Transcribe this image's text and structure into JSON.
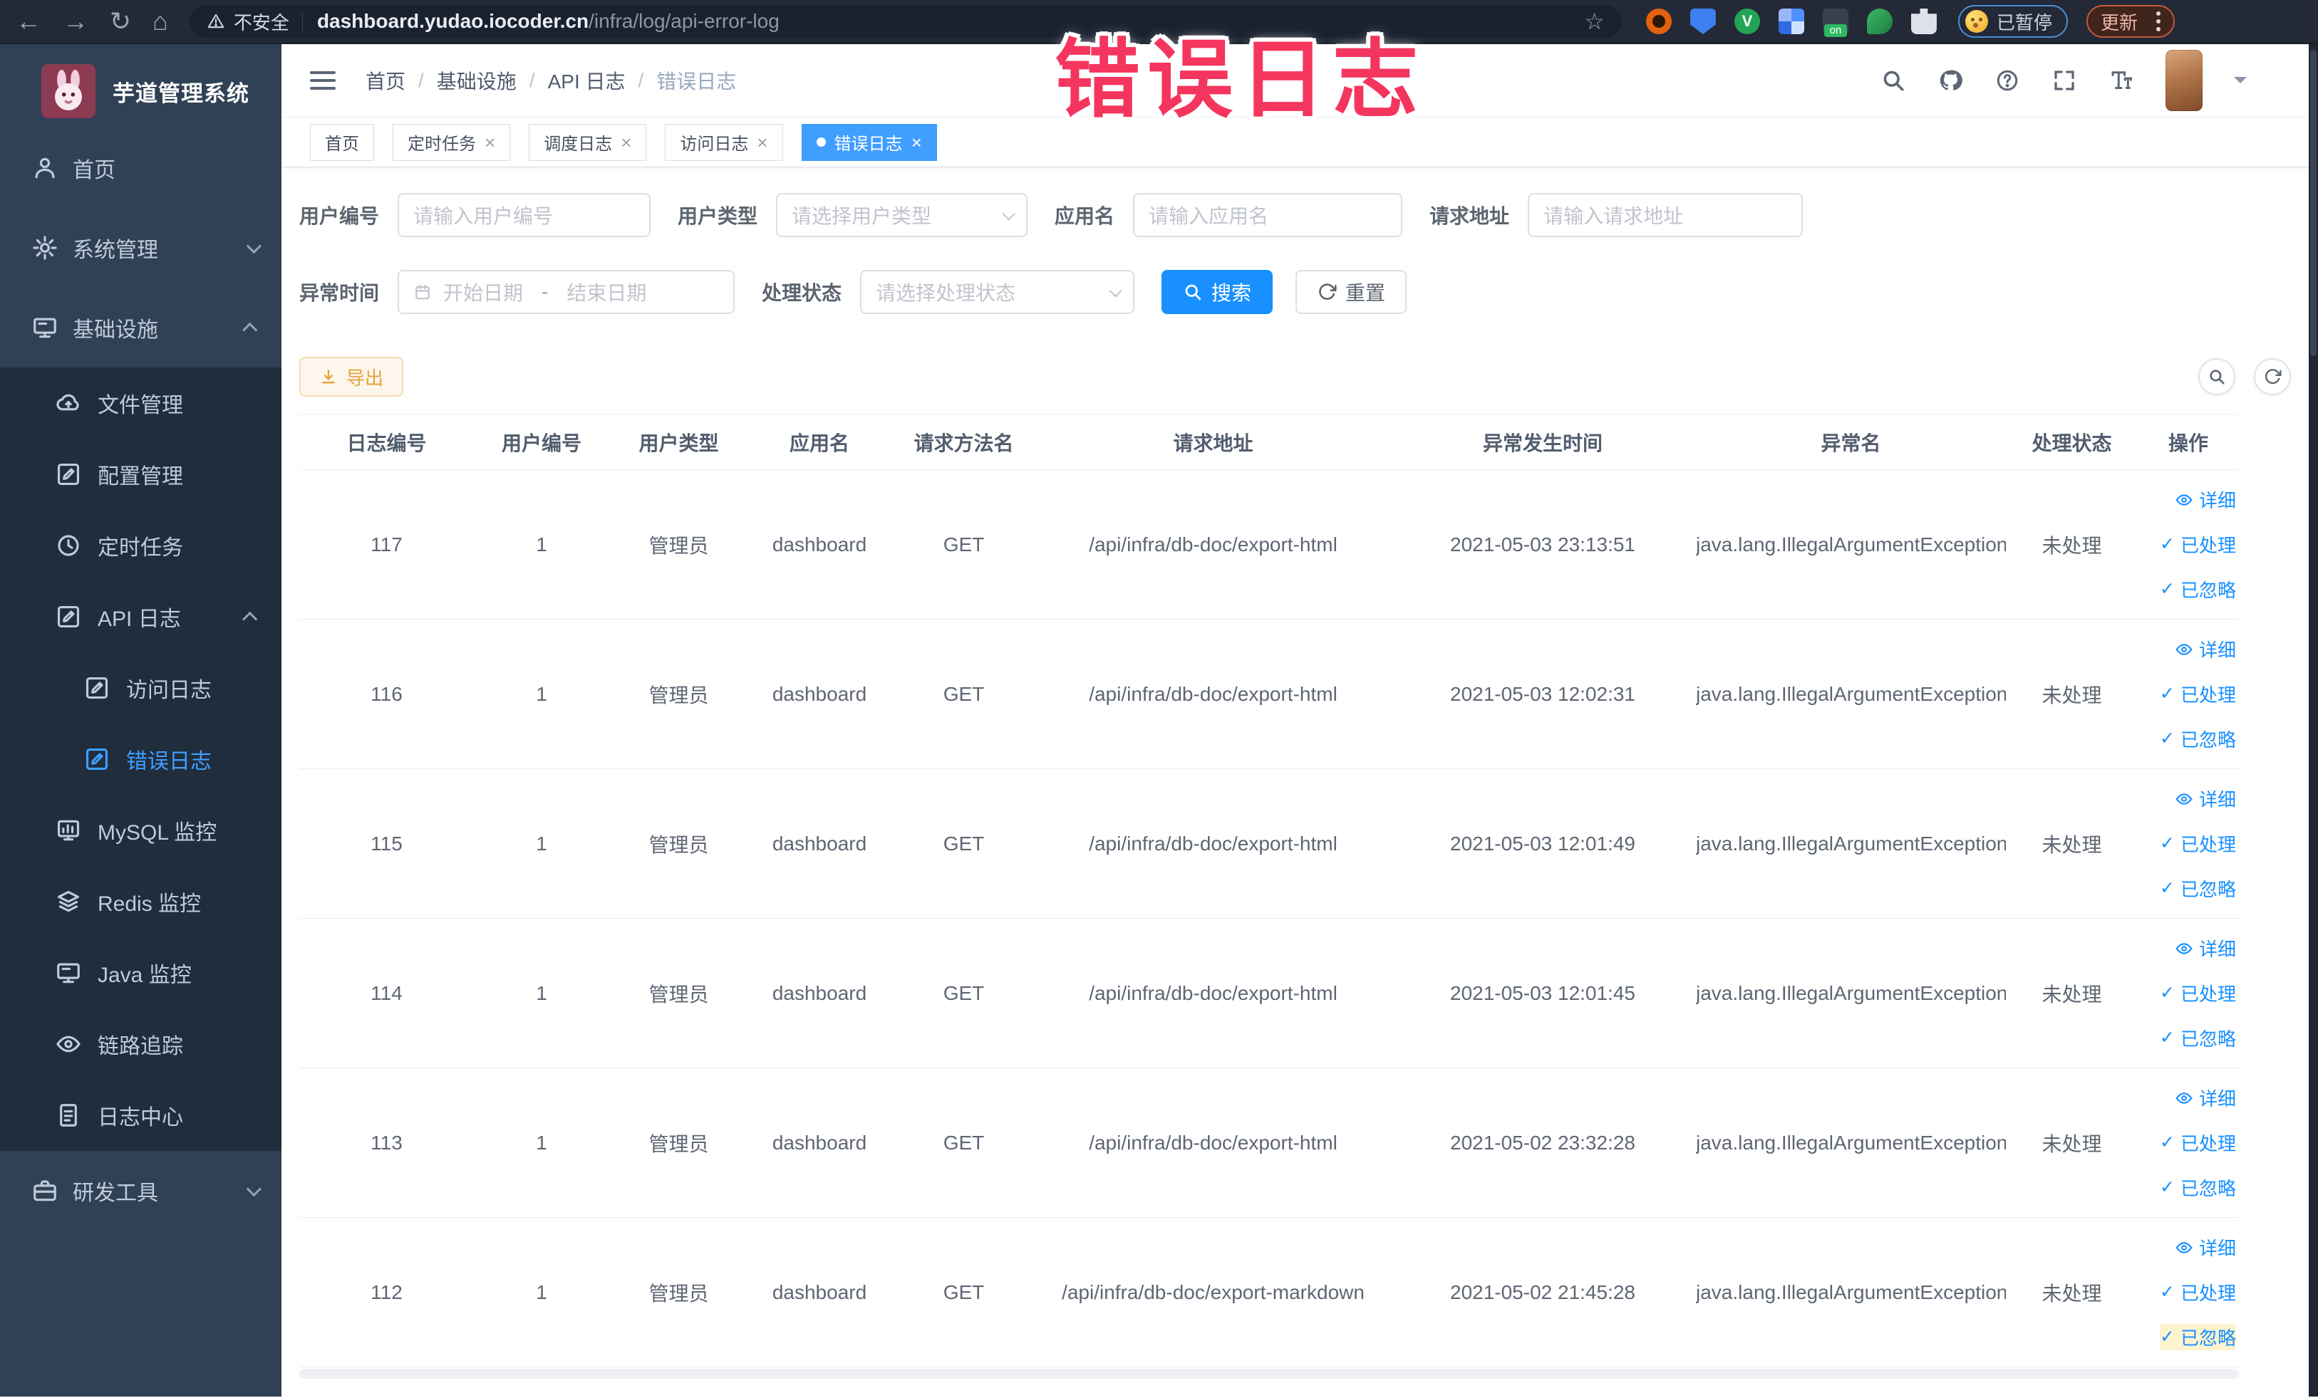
{
  "browser": {
    "security_label": "不安全",
    "url_host": "dashboard.yudao.iocoder.cn",
    "url_path": "/infra/log/api-error-log",
    "extension_icons": [
      "ring-extension-icon",
      "shield-extension-icon",
      "v-extension-icon",
      "grid-extension-icon",
      "switch-extension-icon",
      "leaf-extension-icon",
      "puzzle-extension-icon"
    ],
    "paused_pill": "已暂停",
    "update_button": "更新"
  },
  "annotation": "错误日志",
  "sidebar": {
    "title": "芋道管理系统",
    "items": [
      {
        "label": "首页",
        "icon": "home-icon",
        "section": "root"
      },
      {
        "label": "系统管理",
        "icon": "gear-icon",
        "section": "root",
        "chevron": "down"
      },
      {
        "label": "基础设施",
        "icon": "infra-icon",
        "section": "root",
        "chevron": "up"
      },
      {
        "label": "文件管理",
        "icon": "file-manage-icon",
        "section": "sub",
        "level": 1
      },
      {
        "label": "配置管理",
        "icon": "config-icon",
        "section": "sub",
        "level": 1
      },
      {
        "label": "定时任务",
        "icon": "timer-icon",
        "section": "sub",
        "level": 1
      },
      {
        "label": "API 日志",
        "icon": "api-log-icon",
        "section": "sub",
        "level": 1,
        "chevron": "up"
      },
      {
        "label": "访问日志",
        "icon": "access-log-icon",
        "section": "sub",
        "level": 2
      },
      {
        "label": "错误日志",
        "icon": "error-log-icon",
        "section": "sub",
        "level": 2,
        "active": true
      },
      {
        "label": "MySQL 监控",
        "icon": "mysql-icon",
        "section": "sub",
        "level": 1
      },
      {
        "label": "Redis 监控",
        "icon": "redis-icon",
        "section": "sub",
        "level": 1
      },
      {
        "label": "Java 监控",
        "icon": "java-icon",
        "section": "sub",
        "level": 1
      },
      {
        "label": "链路追踪",
        "icon": "trace-icon",
        "section": "sub",
        "level": 1
      },
      {
        "label": "日志中心",
        "icon": "log-center-icon",
        "section": "sub",
        "level": 1
      },
      {
        "label": "研发工具",
        "icon": "tools-icon",
        "section": "root",
        "chevron": "down"
      }
    ]
  },
  "header": {
    "breadcrumb": [
      "首页",
      "基础设施",
      "API 日志",
      "错误日志"
    ],
    "separator": "/",
    "icons": [
      "search-icon",
      "github-icon",
      "help-icon",
      "fullscreen-icon",
      "font-size-icon"
    ]
  },
  "tabs": [
    {
      "label": "首页"
    },
    {
      "label": "定时任务",
      "closable": true
    },
    {
      "label": "调度日志",
      "closable": true
    },
    {
      "label": "访问日志",
      "closable": true
    },
    {
      "label": "错误日志",
      "closable": true,
      "active": true
    }
  ],
  "filters": {
    "user_id": {
      "label": "用户编号",
      "placeholder": "请输入用户编号"
    },
    "user_type": {
      "label": "用户类型",
      "placeholder": "请选择用户类型"
    },
    "app_name": {
      "label": "应用名",
      "placeholder": "请输入应用名"
    },
    "request_url": {
      "label": "请求地址",
      "placeholder": "请输入请求地址"
    },
    "exception_time": {
      "label": "异常时间",
      "start_placeholder": "开始日期",
      "separator": "-",
      "end_placeholder": "结束日期"
    },
    "process_status": {
      "label": "处理状态",
      "placeholder": "请选择处理状态"
    },
    "search_label": "搜索",
    "reset_label": "重置"
  },
  "toolbar": {
    "export_label": "导出"
  },
  "table": {
    "columns": [
      "日志编号",
      "用户编号",
      "用户类型",
      "应用名",
      "请求方法名",
      "请求地址",
      "异常发生时间",
      "异常名",
      "处理状态",
      "操作"
    ],
    "actions": {
      "detail": "详细",
      "processed": "已处理",
      "ignored": "已忽略"
    },
    "rows": [
      {
        "id": "117",
        "user_id": "1",
        "user_type": "管理员",
        "app": "dashboard",
        "method": "GET",
        "url": "/api/infra/db-doc/export-html",
        "time": "2021-05-03 23:13:51",
        "exception": "java.lang.IllegalArgumentException",
        "status": "未处理"
      },
      {
        "id": "116",
        "user_id": "1",
        "user_type": "管理员",
        "app": "dashboard",
        "method": "GET",
        "url": "/api/infra/db-doc/export-html",
        "time": "2021-05-03 12:02:31",
        "exception": "java.lang.IllegalArgumentException",
        "status": "未处理"
      },
      {
        "id": "115",
        "user_id": "1",
        "user_type": "管理员",
        "app": "dashboard",
        "method": "GET",
        "url": "/api/infra/db-doc/export-html",
        "time": "2021-05-03 12:01:49",
        "exception": "java.lang.IllegalArgumentException",
        "status": "未处理"
      },
      {
        "id": "114",
        "user_id": "1",
        "user_type": "管理员",
        "app": "dashboard",
        "method": "GET",
        "url": "/api/infra/db-doc/export-html",
        "time": "2021-05-03 12:01:45",
        "exception": "java.lang.IllegalArgumentException",
        "status": "未处理"
      },
      {
        "id": "113",
        "user_id": "1",
        "user_type": "管理员",
        "app": "dashboard",
        "method": "GET",
        "url": "/api/infra/db-doc/export-html",
        "time": "2021-05-02 23:32:28",
        "exception": "java.lang.IllegalArgumentException",
        "status": "未处理"
      },
      {
        "id": "112",
        "user_id": "1",
        "user_type": "管理员",
        "app": "dashboard",
        "method": "GET",
        "url": "/api/infra/db-doc/export-markdown",
        "time": "2021-05-02 21:45:28",
        "exception": "java.lang.IllegalArgumentException",
        "status": "未处理",
        "highlight_ignored": true
      }
    ]
  },
  "colors": {
    "accent": "#1890ff",
    "sidebar": "#304156",
    "submenu": "#1f2d3d",
    "active_tab": "#409eff",
    "warning": "#e6a23c",
    "annotation": "#f4355e"
  }
}
